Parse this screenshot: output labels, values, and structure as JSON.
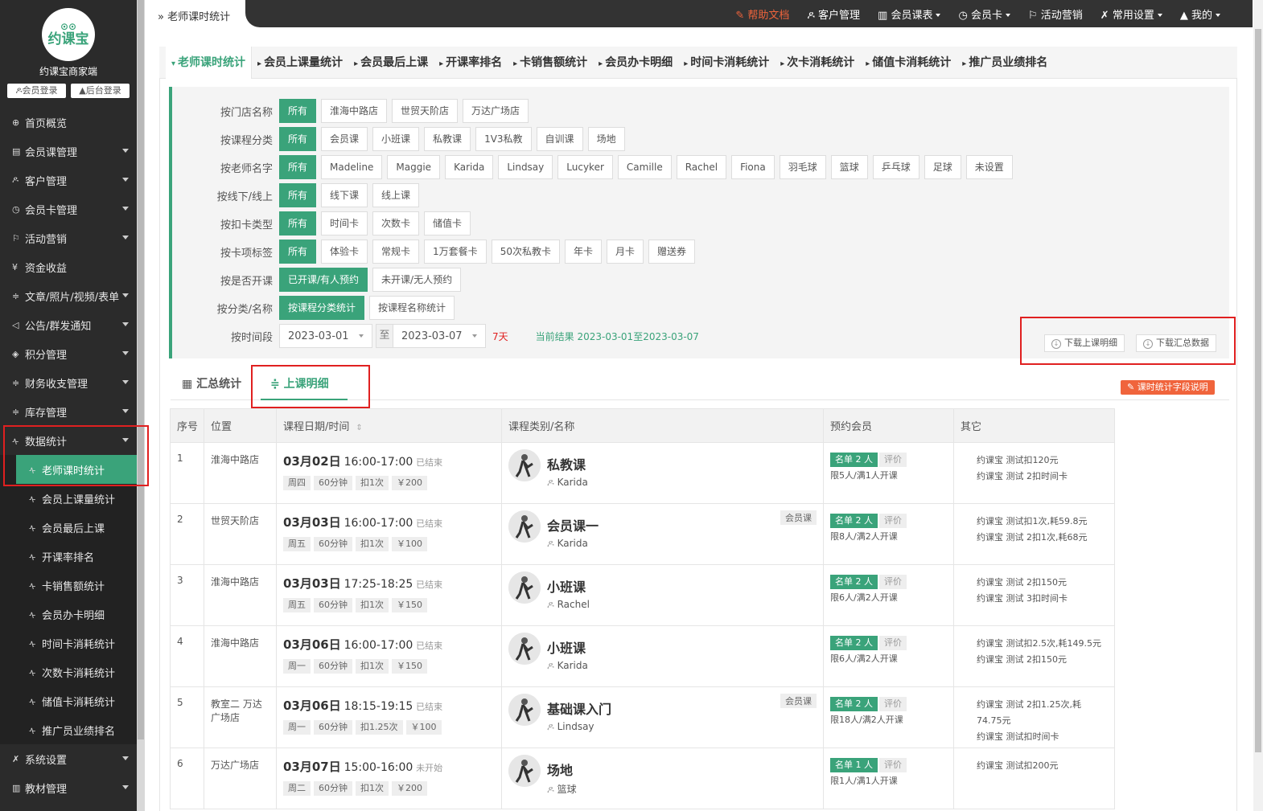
{
  "sidebar": {
    "brand": "约课宝商家端",
    "logo_text": "约课宝",
    "member_login": "会员登录",
    "admin_login": "后台登录",
    "items": [
      {
        "label": "首页概览",
        "icon": "globe-icon",
        "caret": false
      },
      {
        "label": "会员课管理",
        "icon": "doc-icon",
        "caret": true
      },
      {
        "label": "客户管理",
        "icon": "user-icon",
        "caret": true
      },
      {
        "label": "会员卡管理",
        "icon": "clock-icon",
        "caret": true
      },
      {
        "label": "活动营销",
        "icon": "flag-icon",
        "caret": true
      },
      {
        "label": "资金收益",
        "icon": "yen-icon",
        "caret": false
      },
      {
        "label": "文章/照片/视频/表单",
        "icon": "sliders-icon",
        "caret": true
      },
      {
        "label": "公告/群发通知",
        "icon": "megaphone-icon",
        "caret": true
      },
      {
        "label": "积分管理",
        "icon": "diamond-icon",
        "caret": true
      },
      {
        "label": "财务收支管理",
        "icon": "sliders-icon",
        "caret": true
      },
      {
        "label": "库存管理",
        "icon": "sliders-icon",
        "caret": true
      },
      {
        "label": "数据统计",
        "icon": "pulse-icon",
        "caret": true
      }
    ],
    "sub_items": [
      "老师课时统计",
      "会员上课量统计",
      "会员最后上课",
      "开课率排名",
      "卡销售额统计",
      "会员办卡明细",
      "时间卡消耗统计",
      "次数卡消耗统计",
      "储值卡消耗统计",
      "推广员业绩排名"
    ],
    "bottom_items": [
      {
        "label": "系统设置",
        "icon": "tools-icon"
      },
      {
        "label": "教材管理",
        "icon": "book-icon"
      }
    ]
  },
  "header": {
    "breadcrumb": "老师课时统计",
    "help": "帮助文档",
    "nav": [
      {
        "label": "客户管理",
        "dd": false,
        "icon": "user-icon"
      },
      {
        "label": "会员课表",
        "dd": true,
        "icon": "book-icon"
      },
      {
        "label": "会员卡",
        "dd": true,
        "icon": "clock-icon"
      },
      {
        "label": "活动营销",
        "dd": false,
        "icon": "flag-icon"
      },
      {
        "label": "常用设置",
        "dd": true,
        "icon": "tools-icon"
      },
      {
        "label": "我的",
        "dd": true,
        "icon": "person-icon"
      }
    ]
  },
  "tabs": [
    "老师课时统计",
    "会员上课量统计",
    "会员最后上课",
    "开课率排名",
    "卡销售额统计",
    "会员办卡明细",
    "时间卡消耗统计",
    "次卡消耗统计",
    "储值卡消耗统计",
    "推广员业绩排名"
  ],
  "filters": [
    {
      "label": "按门店名称",
      "options": [
        "所有",
        "淮海中路店",
        "世贸天阶店",
        "万达广场店"
      ]
    },
    {
      "label": "按课程分类",
      "options": [
        "所有",
        "会员课",
        "小班课",
        "私教课",
        "1V3私教",
        "自训课",
        "场地"
      ]
    },
    {
      "label": "按老师名字",
      "options": [
        "所有",
        "Madeline",
        "Maggie",
        "Karida",
        "Lindsay",
        "Lucyker",
        "Camille",
        "Rachel",
        "Fiona",
        "羽毛球",
        "篮球",
        "乒乓球",
        "足球",
        "未设置"
      ]
    },
    {
      "label": "按线下/线上",
      "options": [
        "所有",
        "线下课",
        "线上课"
      ]
    },
    {
      "label": "按扣卡类型",
      "options": [
        "所有",
        "时间卡",
        "次数卡",
        "储值卡"
      ]
    },
    {
      "label": "按卡项标签",
      "options": [
        "所有",
        "体验卡",
        "常规卡",
        "1万套餐卡",
        "50次私教卡",
        "年卡",
        "月卡",
        "赠送券"
      ]
    },
    {
      "label": "按是否开课",
      "options": [
        "已开课/有人预约",
        "未开课/无人预约"
      ]
    },
    {
      "label": "按分类/名称",
      "options": [
        "按课程分类统计",
        "按课程名称统计"
      ]
    }
  ],
  "date_filter": {
    "label": "按时间段",
    "start": "2023-03-01",
    "to": "至",
    "end": "2023-03-07",
    "days": "7天",
    "current": "当前结果 2023-03-01至2023-03-07"
  },
  "downloads": {
    "detail": "下载上课明细",
    "summary": "下载汇总数据"
  },
  "subtabs": {
    "summary": "汇总统计",
    "detail": "上课明细"
  },
  "explain": "课时统计字段说明",
  "table": {
    "headers": [
      "序号",
      "位置",
      "课程日期/时间",
      "课程类别/名称",
      "预约会员",
      "其它"
    ],
    "rows": [
      {
        "no": "1",
        "loc": "淮海中路店",
        "date": "03月02日",
        "time": "16:00-17:00",
        "status": "已结束",
        "week": "周四",
        "dur": "60分钟",
        "deduct": "扣1次",
        "price": "￥200",
        "name": "私教课",
        "teacher": "Karida",
        "tag": "",
        "count": "名单 2 人",
        "eval": "评价",
        "limit": "限5人/满1人开课",
        "other": [
          "约课宝 测试扣120元",
          "约课宝 测试 2扣时间卡"
        ]
      },
      {
        "no": "2",
        "loc": "世贸天阶店",
        "date": "03月03日",
        "time": "16:00-17:00",
        "status": "已结束",
        "week": "周五",
        "dur": "60分钟",
        "deduct": "扣1次",
        "price": "￥100",
        "name": "会员课一",
        "teacher": "Karida",
        "tag": "会员课",
        "count": "名单 2 人",
        "eval": "评价",
        "limit": "限8人/满2人开课",
        "other": [
          "约课宝 测试扣1次,耗59.8元",
          "约课宝 测试 2扣1次,耗68元"
        ]
      },
      {
        "no": "3",
        "loc": "淮海中路店",
        "date": "03月03日",
        "time": "17:25-18:25",
        "status": "已结束",
        "week": "周五",
        "dur": "60分钟",
        "deduct": "扣1次",
        "price": "￥150",
        "name": "小班课",
        "teacher": "Rachel",
        "tag": "",
        "count": "名单 2 人",
        "eval": "评价",
        "limit": "限6人/满2人开课",
        "other": [
          "约课宝 测试 2扣150元",
          "约课宝 测试 3扣时间卡"
        ]
      },
      {
        "no": "4",
        "loc": "淮海中路店",
        "date": "03月06日",
        "time": "16:00-17:00",
        "status": "已结束",
        "week": "周一",
        "dur": "60分钟",
        "deduct": "扣1次",
        "price": "￥150",
        "name": "小班课",
        "teacher": "Karida",
        "tag": "",
        "count": "名单 2 人",
        "eval": "评价",
        "limit": "限6人/满2人开课",
        "other": [
          "约课宝 测试扣2.5次,耗149.5元",
          "约课宝 测试 2扣150元"
        ]
      },
      {
        "no": "5",
        "loc": "教室二 万达广场店",
        "date": "03月06日",
        "time": "18:15-19:15",
        "status": "已结束",
        "week": "周一",
        "dur": "60分钟",
        "deduct": "扣1.25次",
        "price": "￥100",
        "name": "基础课入门",
        "teacher": "Lindsay",
        "tag": "会员课",
        "count": "名单 2 人",
        "eval": "评价",
        "limit": "限18人/满2人开课",
        "other": [
          "约课宝 测试 2扣1.25次,耗 74.75元",
          "约课宝 测试扣时间卡"
        ]
      },
      {
        "no": "6",
        "loc": "万达广场店",
        "date": "03月07日",
        "time": "15:00-16:00",
        "status": "未开始",
        "week": "周二",
        "dur": "60分钟",
        "deduct": "扣1次",
        "price": "￥200",
        "name": "场地",
        "teacher": "篮球",
        "tag": "",
        "count": "名单 1 人",
        "eval": "评价",
        "limit": "限1人/满1人开课",
        "other": [
          "约课宝 测试扣200元"
        ]
      }
    ]
  },
  "colors": {
    "accent": "#3aa37a",
    "highlight": "#e02020",
    "help": "#f0643c"
  }
}
